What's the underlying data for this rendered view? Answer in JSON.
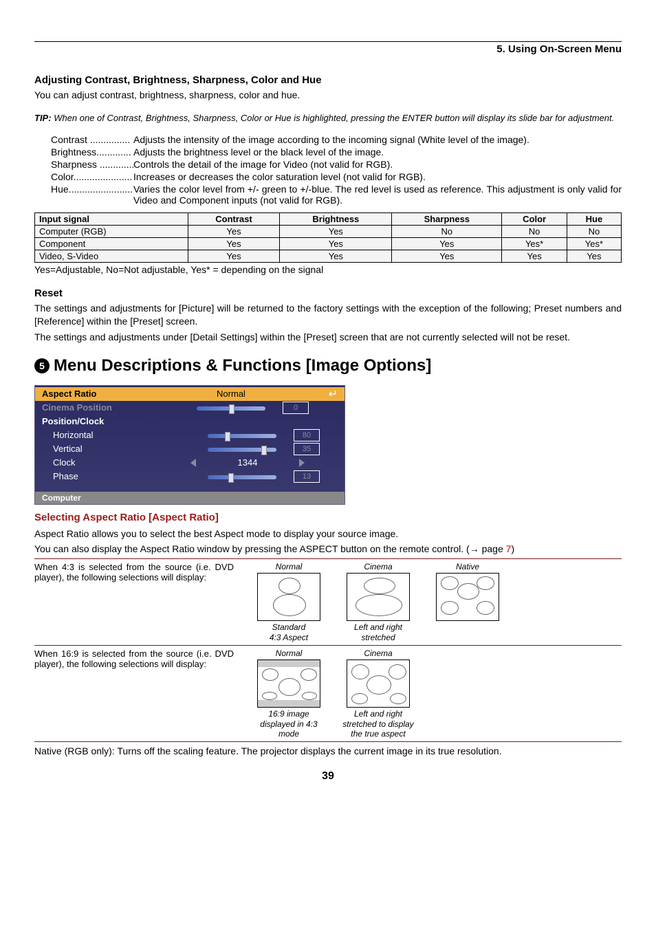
{
  "section_header": "5. Using On-Screen Menu",
  "h_adjust": "Adjusting Contrast, Brightness, Sharpness, Color and Hue",
  "adjust_intro": "You can adjust contrast, brightness, sharpness, color and hue.",
  "tip_label": "TIP:",
  "tip_text": "When one of Contrast, Brightness, Sharpness, Color or Hue is highlighted, pressing the ENTER button will display its slide bar for adjustment.",
  "defs": {
    "contrast": {
      "term": "Contrast ...............",
      "desc": "Adjusts the intensity of the image according to the incoming signal (White level of the image)."
    },
    "brightness": {
      "term": "Brightness.............",
      "desc": "Adjusts the brightness level or the black level of the image."
    },
    "sharpness": {
      "term": "Sharpness .............",
      "desc": "Controls the detail of the image for Video (not valid for RGB)."
    },
    "color": {
      "term": "Color......................",
      "desc": "Increases or decreases the color saturation level (not valid for RGB)."
    },
    "hue_term": "Hue........................",
    "hue_desc": "Varies the color level from +/- green to +/-blue. The red level is used as reference. This adjustment is only valid for Video and Component inputs (not valid for RGB)."
  },
  "table": {
    "headers": [
      "Input signal",
      "Contrast",
      "Brightness",
      "Sharpness",
      "Color",
      "Hue"
    ],
    "rows": [
      [
        "Computer (RGB)",
        "Yes",
        "Yes",
        "No",
        "No",
        "No"
      ],
      [
        "Component",
        "Yes",
        "Yes",
        "Yes",
        "Yes*",
        "Yes*"
      ],
      [
        "Video, S-Video",
        "Yes",
        "Yes",
        "Yes",
        "Yes",
        "Yes"
      ]
    ]
  },
  "table_legend": "Yes=Adjustable, No=Not adjustable, Yes* = depending on the signal",
  "h_reset": "Reset",
  "reset_p1": "The settings and adjustments for [Picture] will be returned to the factory settings with the exception of the following; Preset numbers and [Reference] within the [Preset] screen.",
  "reset_p2": "The settings and adjustments under [Detail Settings] within the [Preset] screen that are not currently selected will not be reset.",
  "big_num": "5",
  "big_heading": "Menu Descriptions & Functions [Image Options]",
  "menu": {
    "aspect": "Aspect Ratio",
    "aspect_val": "Normal",
    "cinema": "Cinema Position",
    "cinema_val": "0",
    "posclk": "Position/Clock",
    "horiz": "Horizontal",
    "horiz_val": "80",
    "vert": "Vertical",
    "vert_val": "35",
    "clock": "Clock",
    "clock_val": "1344",
    "phase": "Phase",
    "phase_val": "13",
    "footer": "Computer"
  },
  "h_aspect": "Selecting Aspect Ratio [Aspect Ratio]",
  "aspect_p1": "Aspect Ratio allows you to select the best Aspect mode to display your source image.",
  "aspect_p2_a": "You can also display the Aspect Ratio window by pressing the ASPECT button on the remote control. (",
  "aspect_p2_arrow": "→",
  "aspect_p2_page": " page ",
  "aspect_p2_num": "7",
  "aspect_p2_end": ")",
  "ar43_desc": "When 4:3 is selected from the source (i.e. DVD player), the following selections will display:",
  "ar169_desc": "When 16:9 is selected from the source (i.e. DVD player), the following selections will display:",
  "labels": {
    "normal": "Normal",
    "cinema": "Cinema",
    "native": "Native",
    "standard43": "Standard\n4:3 Aspect",
    "lr_stretched": "Left and right\nstretched",
    "img169in43": "16:9 image\ndisplayed in 4:3\nmode",
    "lr_true": "Left and right\nstretched to display\nthe true aspect"
  },
  "native_note": "Native (RGB only): Turns off the scaling feature. The projector displays the current image in its true resolution.",
  "page_number": "39"
}
